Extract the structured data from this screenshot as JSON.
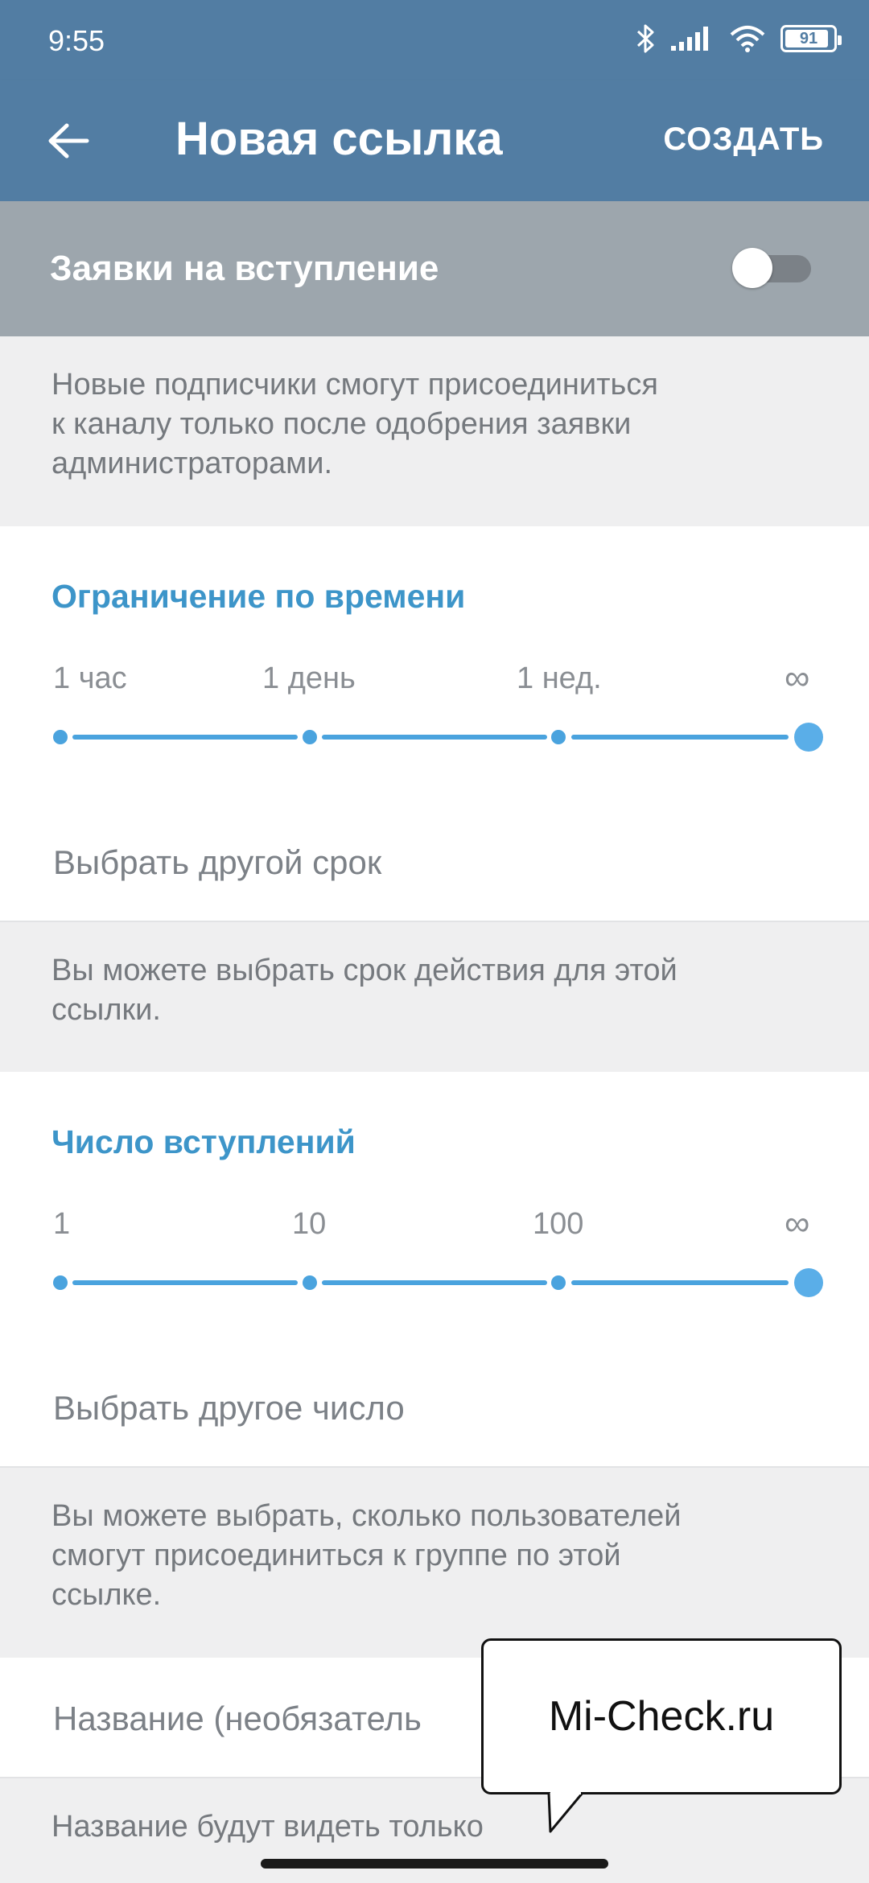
{
  "status_bar": {
    "time": "9:55",
    "battery": "91",
    "battery_level": 0.91
  },
  "app_bar": {
    "title": "Новая ссылка",
    "create_label": "СОЗДАТЬ",
    "back_icon": "arrow-left-icon"
  },
  "join_requests": {
    "label": "Заявки на вступление",
    "enabled": false,
    "description": "Новые подписчики смогут присоединиться\nк каналу только после одобрения заявки\nадминистраторами."
  },
  "time_limit": {
    "title": "Ограничение по времени",
    "ticks": [
      "1 час",
      "1 день",
      "1 нед.",
      "∞"
    ],
    "selected": "∞",
    "custom_label": "Выбрать другой срок",
    "description": "Вы можете выбрать срок действия для этой\nссылки."
  },
  "join_limit": {
    "title": "Число вступлений",
    "ticks": [
      "1",
      "10",
      "100",
      "∞"
    ],
    "selected": "∞",
    "custom_label": "Выбрать другое число",
    "description": "Вы можете выбрать, сколько пользователей\nсмогут присоединиться к группе по этой\nссылке."
  },
  "name_field": {
    "placeholder": "Название (необязатель",
    "description": "Название будут видеть только"
  },
  "watermark": {
    "text": "Mi-Check.ru"
  },
  "colors": {
    "header": "#527da3",
    "accent": "#4aa3de",
    "section_title": "#3d95c9",
    "background": "#efeff0"
  }
}
